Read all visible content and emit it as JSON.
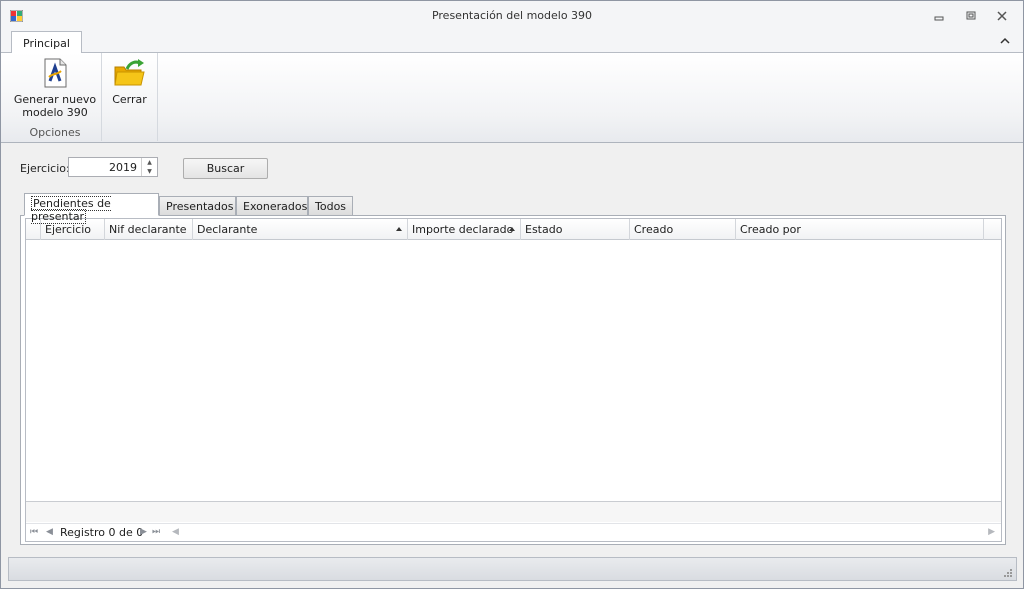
{
  "window": {
    "title": "Presentación del modelo 390",
    "app_icon": "windows-form-icon",
    "controls": [
      "minimize-icon",
      "restore-icon",
      "close-icon"
    ]
  },
  "ribbon": {
    "tab": "Principal",
    "groups": [
      {
        "label": "Opciones",
        "buttons": [
          {
            "label_line1": "Generar nuevo",
            "label_line2": "modelo 390",
            "icon": "document-aeat-icon"
          }
        ]
      },
      {
        "label": "",
        "buttons": [
          {
            "label_line1": "Cerrar",
            "icon": "folder-exit-icon"
          }
        ]
      }
    ]
  },
  "filter": {
    "ejercicio_label": "Ejercicio:",
    "ejercicio_value": "2019",
    "search_button": "Buscar"
  },
  "tabs": [
    {
      "label": "Pendientes de presentar",
      "active": true
    },
    {
      "label": "Presentados",
      "active": false
    },
    {
      "label": "Exonerados",
      "active": false
    },
    {
      "label": "Todos",
      "active": false
    }
  ],
  "grid": {
    "columns": [
      {
        "label": "Ejercicio"
      },
      {
        "label": "Nif declarante"
      },
      {
        "label": "Declarante",
        "sorted": "asc"
      },
      {
        "label": "Importe declarado",
        "sorted": "asc"
      },
      {
        "label": "Estado"
      },
      {
        "label": "Creado"
      },
      {
        "label": "Creado por"
      }
    ],
    "rows": [],
    "navigator_text": "Registro 0 de 0"
  },
  "colors": {
    "window_border": "#8f96a3",
    "ribbon_bg": "#f2f3f5",
    "folder_yellow": "#f5c518",
    "arrow_green": "#3aa335"
  }
}
